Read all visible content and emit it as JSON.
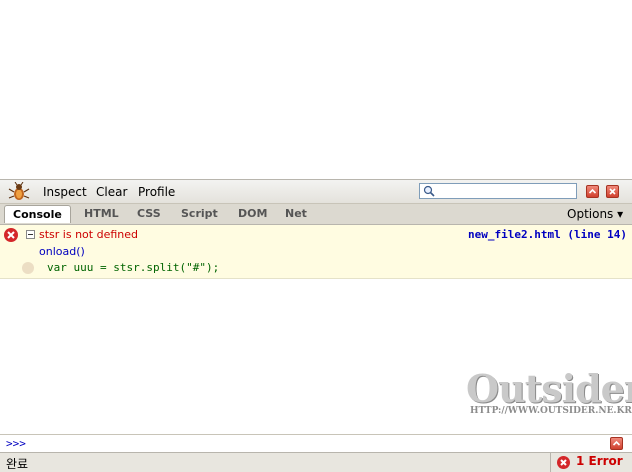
{
  "toolbar": {
    "commands": [
      "Inspect",
      "Clear",
      "Profile"
    ],
    "search": {
      "value": "",
      "placeholder": ""
    }
  },
  "tabs": [
    {
      "label": "Console",
      "selected": true
    },
    {
      "label": "HTML",
      "selected": false
    },
    {
      "label": "CSS",
      "selected": false
    },
    {
      "label": "Script",
      "selected": false
    },
    {
      "label": "DOM",
      "selected": false
    },
    {
      "label": "Net",
      "selected": false
    }
  ],
  "options_label": "Options ▾",
  "console": {
    "error": {
      "message": "stsr is not defined",
      "source": "new_file2.html (line 14)",
      "function": "onload()",
      "code": "var uuu = stsr.split(\"#\");"
    },
    "prompt": ">>>"
  },
  "watermark": {
    "title": "Outsider",
    "url": "HTTP://WWW.OUTSIDER.NE.KR"
  },
  "statusbar": {
    "text": "완료",
    "error_count": "1 Error"
  },
  "colors": {
    "error_red": "#c00000",
    "link_blue": "#0000c0",
    "error_row_bg": "#fffce1",
    "toolbar_bg": "#e4e2dc"
  }
}
